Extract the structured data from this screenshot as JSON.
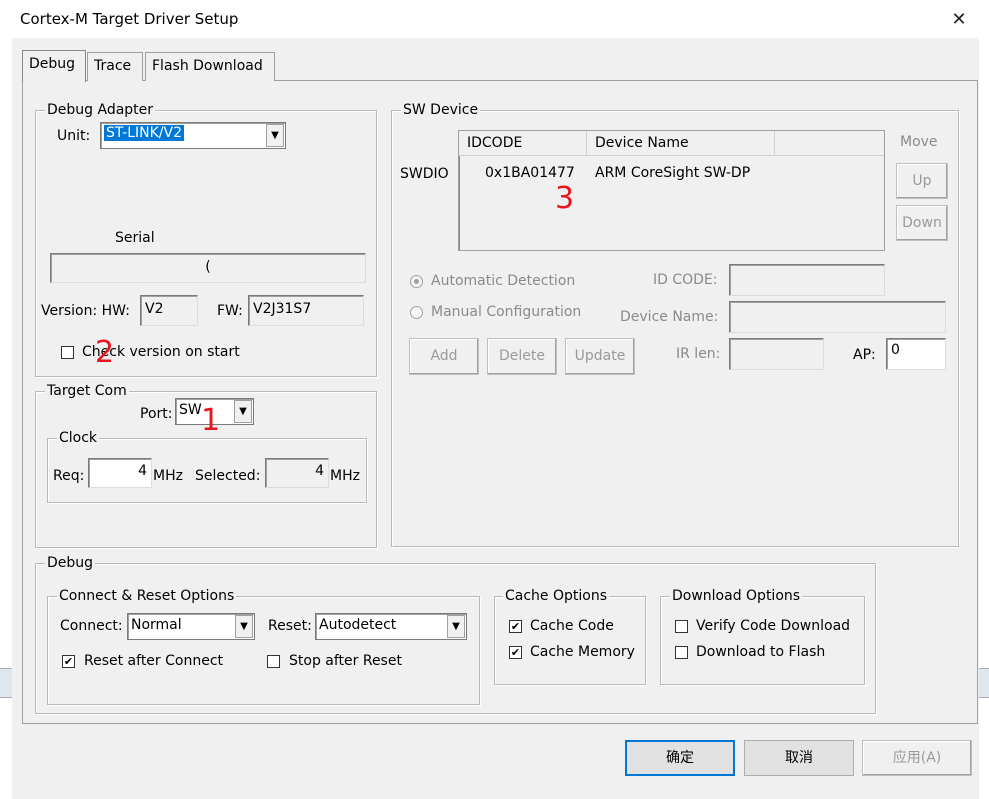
{
  "window": {
    "title": "Cortex-M Target Driver Setup",
    "close_glyph": "✕"
  },
  "tabs": [
    {
      "label": "Debug",
      "active": true
    },
    {
      "label": "Trace",
      "active": false
    },
    {
      "label": "Flash Download",
      "active": false
    }
  ],
  "debug_adapter": {
    "title": "Debug Adapter",
    "unit_label": "Unit:",
    "unit_value": "ST-LINK/V2",
    "serial_label": "Serial",
    "serial_value": "(",
    "version_hw_label": "Version: HW:",
    "hw_value": "V2",
    "fw_label": "FW:",
    "fw_value": "V2J31S7",
    "check_version_label": "Check version on start",
    "check_version_checked": false
  },
  "target_com": {
    "title": "Target Com",
    "port_label": "Port:",
    "port_value": "SW",
    "clock": {
      "title": "Clock",
      "req_label": "Req:",
      "req_value": "4",
      "unit1": "MHz",
      "selected_label": "Selected:",
      "selected_value": "4",
      "unit2": "MHz"
    }
  },
  "sw_device": {
    "title": "SW Device",
    "row_label": "SWDIO",
    "columns": [
      "IDCODE",
      "Device Name"
    ],
    "rows": [
      {
        "idcode": "0x1BA01477",
        "device_name": "ARM CoreSight SW-DP"
      }
    ],
    "move_label": "Move",
    "up_label": "Up",
    "down_label": "Down",
    "auto_detect_label": "Automatic Detection",
    "manual_config_label": "Manual Configuration",
    "id_code_label": "ID CODE:",
    "device_name_label": "Device Name:",
    "add_label": "Add",
    "delete_label": "Delete",
    "update_label": "Update",
    "ir_len_label": "IR len:",
    "ap_label": "AP:",
    "ap_value": "0"
  },
  "debug": {
    "title": "Debug",
    "connect_reset": {
      "title": "Connect & Reset Options",
      "connect_label": "Connect:",
      "connect_value": "Normal",
      "reset_label": "Reset:",
      "reset_value": "Autodetect",
      "reset_after_connect_label": "Reset after Connect",
      "reset_after_connect_checked": true,
      "stop_after_reset_label": "Stop after Reset",
      "stop_after_reset_checked": false
    },
    "cache_options": {
      "title": "Cache Options",
      "cache_code_label": "Cache Code",
      "cache_code_checked": true,
      "cache_memory_label": "Cache Memory",
      "cache_memory_checked": true
    },
    "download_options": {
      "title": "Download Options",
      "verify_label": "Verify Code Download",
      "verify_checked": false,
      "download_flash_label": "Download to Flash",
      "download_flash_checked": false
    }
  },
  "footer": {
    "ok_label": "确定",
    "cancel_label": "取消",
    "apply_label": "应用(A)"
  },
  "annotations": {
    "mark1": "1",
    "mark2": "2",
    "mark3": "3",
    "color": "#e8141e"
  },
  "check_glyph": "✔",
  "arrow_glyph": "▼"
}
